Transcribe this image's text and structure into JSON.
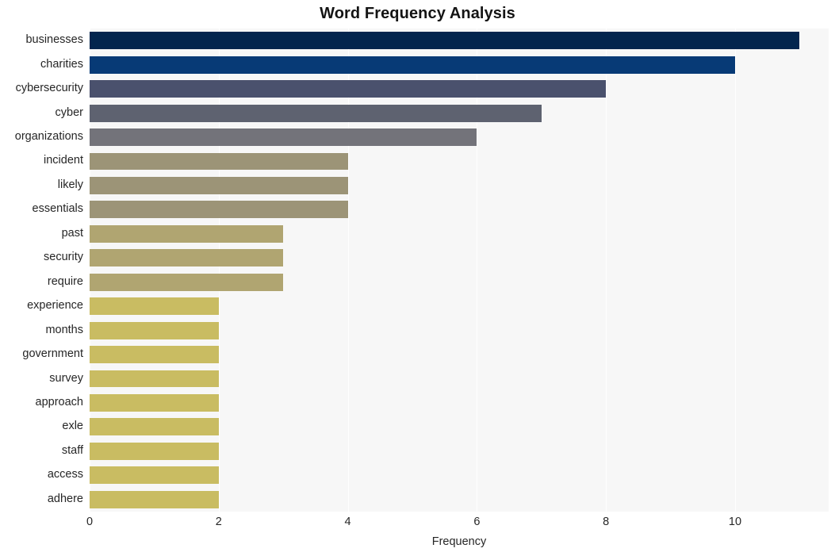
{
  "chart_data": {
    "type": "bar",
    "orientation": "horizontal",
    "title": "Word Frequency Analysis",
    "xlabel": "Frequency",
    "ylabel": "",
    "xlim": [
      0,
      11.45
    ],
    "xticks": [
      0,
      2,
      4,
      6,
      8,
      10
    ],
    "xtick_labels": [
      "0",
      "2",
      "4",
      "6",
      "8",
      "10"
    ],
    "grid": "vertical",
    "legend": "none",
    "plot_background": "#f7f7f7",
    "categories": [
      "businesses",
      "charities",
      "cybersecurity",
      "cyber",
      "organizations",
      "incident",
      "likely",
      "essentials",
      "past",
      "security",
      "require",
      "experience",
      "months",
      "government",
      "survey",
      "approach",
      "exle",
      "staff",
      "access",
      "adhere"
    ],
    "values": [
      11,
      10,
      8,
      7,
      6,
      4,
      4,
      4,
      3,
      3,
      3,
      2,
      2,
      2,
      2,
      2,
      2,
      2,
      2,
      2
    ],
    "bar_colors": [
      "#03254e",
      "#073a76",
      "#4a516d",
      "#5e6270",
      "#73737a",
      "#9c9477",
      "#9c9477",
      "#9c9477",
      "#b0a571",
      "#b0a571",
      "#b0a571",
      "#c9bc62",
      "#c9bc62",
      "#c9bc62",
      "#c9bc62",
      "#c9bc62",
      "#c9bc62",
      "#c9bc62",
      "#c9bc62",
      "#c9bc62"
    ]
  }
}
